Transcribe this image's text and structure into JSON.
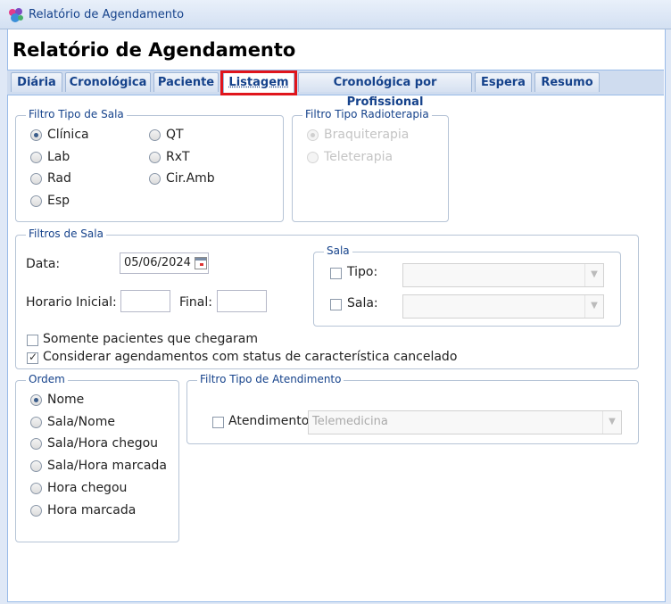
{
  "window": {
    "title": "Relatório de Agendamento"
  },
  "page": {
    "heading": "Relatório de Agendamento"
  },
  "tabs": [
    {
      "label": "Diária"
    },
    {
      "label": "Cronológica"
    },
    {
      "label": "Paciente"
    },
    {
      "label": "Listagem",
      "active": true
    },
    {
      "label": "Cronológica por Profissional"
    },
    {
      "label": "Espera"
    },
    {
      "label": "Resumo"
    }
  ],
  "filtro_tipo_sala": {
    "legend": "Filtro Tipo de Sala",
    "options": [
      {
        "label": "Clínica",
        "checked": true
      },
      {
        "label": "Lab"
      },
      {
        "label": "Rad"
      },
      {
        "label": "Esp"
      },
      {
        "label": "QT"
      },
      {
        "label": "RxT"
      },
      {
        "label": "Cir.Amb"
      }
    ]
  },
  "filtro_tipo_radioterapia": {
    "legend": "Filtro Tipo Radioterapia",
    "options": [
      {
        "label": "Braquiterapia",
        "checked": true,
        "disabled": true
      },
      {
        "label": "Teleterapia",
        "disabled": true
      }
    ]
  },
  "filtros_sala": {
    "legend": "Filtros de Sala",
    "data_label": "Data:",
    "data_value": "05/06/2024",
    "horario_inicial_label": "Horario Inicial:",
    "horario_inicial_value": "",
    "final_label": "Final:",
    "final_value": "",
    "somente_chegaram_label": "Somente pacientes que chegaram",
    "somente_chegaram_checked": false,
    "considerar_cancelado_label": "Considerar agendamentos com status de característica cancelado",
    "considerar_cancelado_checked": true,
    "sala_group": {
      "legend": "Sala",
      "tipo_label": "Tipo:",
      "tipo_value": "",
      "sala_label": "Sala:",
      "sala_value": ""
    }
  },
  "ordem": {
    "legend": "Ordem",
    "options": [
      {
        "label": "Nome",
        "checked": true
      },
      {
        "label": "Sala/Nome"
      },
      {
        "label": "Sala/Hora chegou"
      },
      {
        "label": "Sala/Hora marcada"
      },
      {
        "label": "Hora chegou"
      },
      {
        "label": "Hora marcada"
      }
    ]
  },
  "filtro_tipo_atendimento": {
    "legend": "Filtro Tipo de Atendimento",
    "atendimento_label": "Atendimento",
    "atendimento_checked": false,
    "atendimento_value": "Telemedicina"
  },
  "icons": {
    "app": "app-logo-icon",
    "calendar": "calendar-icon",
    "dropdown": "chevron-down-icon"
  },
  "colors": {
    "accent": "#15428b",
    "highlight_border": "#e0151c",
    "window_border": "#99bbe8"
  }
}
